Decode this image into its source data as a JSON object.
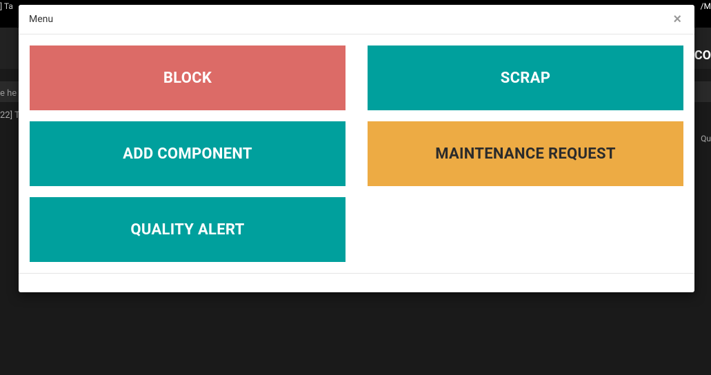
{
  "bg": {
    "top_left": "] Ta",
    "top_right": "/M",
    "row2_right": "CO",
    "row3_left": "e he",
    "row4_left": "22] T",
    "row4_right": "Qu"
  },
  "modal": {
    "title": "Menu",
    "close_label": "×",
    "tiles": {
      "block": "BLOCK",
      "scrap": "SCRAP",
      "add_component": "ADD COMPONENT",
      "maintenance_request": "MAINTENANCE REQUEST",
      "quality_alert": "QUALITY ALERT"
    }
  }
}
